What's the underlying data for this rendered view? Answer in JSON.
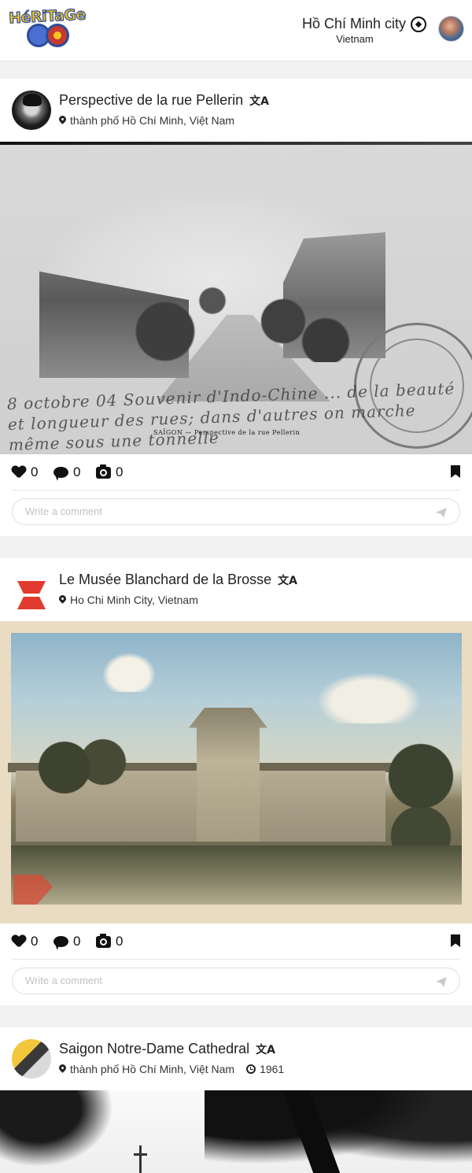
{
  "header": {
    "logo_text": "HéRiTaGe GO",
    "city": "Hồ Chí Minh city",
    "country": "Vietnam",
    "icons": {
      "compass": "compass-icon",
      "avatar": "user-avatar"
    }
  },
  "posts": [
    {
      "title": "Perspective de la rue Pellerin",
      "location": "thành phố Hồ Chí Minh, Việt Nam",
      "photo_caption": "SAÏGON — Perspective de la rue Pellerin",
      "photo_handwriting": "8 octobre 04 Souvenir d'Indo-Chine ... de la beauté et longueur des rues; dans d'autres on marche même sous une tonnelle",
      "photo_stamp": "MÉDECIN-MAJOR",
      "likes": "0",
      "comments": "0",
      "photos": "0",
      "comment_placeholder": "Write a comment"
    },
    {
      "title": "Le Musée Blanchard de la Brosse",
      "location": "Ho Chi Minh City, Vietnam",
      "likes": "0",
      "comments": "0",
      "photos": "0",
      "comment_placeholder": "Write a comment"
    },
    {
      "title": "Saigon Notre-Dame Cathedral",
      "location": "thành phố Hồ Chí Minh, Việt Nam",
      "year": "1961"
    }
  ],
  "ui_icons": {
    "translate": "文A",
    "like": "heart-icon",
    "comment": "comment-bubble-icon",
    "photo": "camera-icon",
    "bookmark": "bookmark-icon",
    "send": "send-icon",
    "location": "map-pin-icon",
    "date": "clock-icon"
  },
  "colors": {
    "logo_yellow": "#f7c51e",
    "logo_blue": "#2d4c9a",
    "museum_red": "#e03b2e",
    "placeholder_gray": "#c2c2c2"
  }
}
